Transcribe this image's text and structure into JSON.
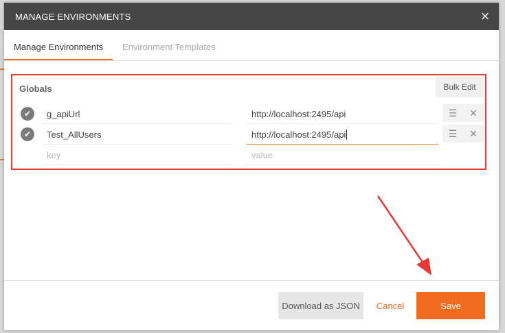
{
  "modal": {
    "title": "MANAGE ENVIRONMENTS",
    "close_icon": "×"
  },
  "tabs": [
    {
      "label": "Manage Environments",
      "active": true
    },
    {
      "label": "Environment Templates",
      "active": false
    }
  ],
  "globals": {
    "title": "Globals",
    "bulk_edit_label": "Bulk Edit",
    "rows": [
      {
        "key": "g_apiUrl",
        "value": "http://localhost:2495/api",
        "enabled": true
      },
      {
        "key": "Test_AllUsers",
        "value": "http://localhost:2495/api",
        "enabled": true
      }
    ],
    "new_row": {
      "key_placeholder": "key",
      "value_placeholder": "value"
    }
  },
  "footer": {
    "download_label": "Download as JSON",
    "cancel_label": "Cancel",
    "save_label": "Save"
  },
  "colors": {
    "accent": "#f26b21",
    "header_bg": "#464646",
    "highlight_box": "#e53935"
  },
  "icons": {
    "check": "check-circle-icon",
    "menu": "hamburger-icon",
    "delete": "close-icon",
    "annotation": "red-arrow"
  }
}
